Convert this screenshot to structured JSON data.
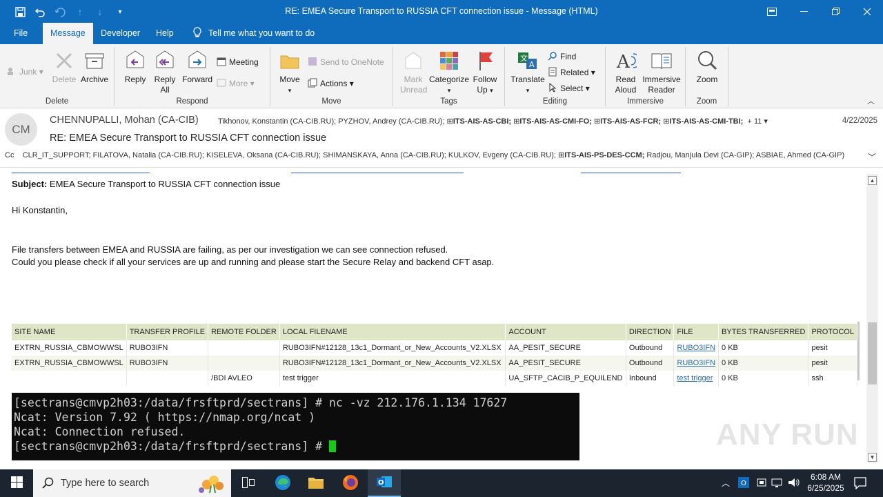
{
  "window": {
    "title": "RE: EMEA Secure Transport to RUSSIA CFT connection issue  -  Message (HTML)"
  },
  "menu": {
    "tabs": [
      "File",
      "Message",
      "Developer",
      "Help"
    ],
    "active_tab": "Message",
    "tell_me": "Tell me what you want to do"
  },
  "ribbon": {
    "groups": {
      "delete": "Delete",
      "respond": "Respond",
      "move": "Move",
      "tags": "Tags",
      "editing": "Editing",
      "immersive": "Immersive",
      "zoom": "Zoom"
    },
    "junk": "Junk",
    "delete_btn": "Delete",
    "archive": "Archive",
    "reply": "Reply",
    "reply_all_1": "Reply",
    "reply_all_2": "All",
    "forward": "Forward",
    "meeting": "Meeting",
    "more": "More",
    "move_btn": "Move",
    "send_onenote": "Send to OneNote",
    "actions": "Actions",
    "mark_unread_1": "Mark",
    "mark_unread_2": "Unread",
    "categorize": "Categorize",
    "follow_up_1": "Follow",
    "follow_up_2": "Up",
    "translate": "Translate",
    "find": "Find",
    "related": "Related",
    "select": "Select",
    "read_aloud_1": "Read",
    "read_aloud_2": "Aloud",
    "immersive_reader_1": "Immersive",
    "immersive_reader_2": "Reader",
    "zoom_btn": "Zoom"
  },
  "header": {
    "avatar_initials": "CM",
    "sender": "CHENNUPALLI, Mohan (CA-CIB)",
    "to_plain": "Tikhonov, Konstantin (CA-CIB.RU); PYZHOV, Andrey (CA-CIB.RU);",
    "to_groups": [
      "ITS-AIS-AS-CBI;",
      "ITS-AIS-AS-CMI-FO;",
      "ITS-AIS-AS-FCR;",
      "ITS-AIS-AS-CMI-TBI;"
    ],
    "to_more": "+ 11",
    "date": "4/22/2025",
    "subject": "RE: EMEA Secure Transport to RUSSIA CFT connection issue",
    "cc_label": "Cc",
    "cc_plain_1": "CLR_IT_SUPPORT; FILATOVA, Natalia (CA-CIB.RU); KISELEVA, Oksana (CA-CIB.RU); SHIMANSKAYA, Anna (CA-CIB.RU); KULKOV, Evgeny (CA-CIB.RU);",
    "cc_group": "ITS-AIS-PS-DES-CCM;",
    "cc_plain_2": "Radjou, Manjula Devi (CA-GIP); ASBIAE, Ahmed (CA-GIP)"
  },
  "body": {
    "subject_label": "Subject:",
    "subject_text": "EMEA Secure Transport to RUSSIA CFT connection issue",
    "greeting": "Hi Konstantin,",
    "para1": "File transfers between EMEA and RUSSIA are failing, as per our investigation we can see connection refused.",
    "para2": "Could you please check if all your services are up and running  and please start the Secure Relay and backend CFT asap."
  },
  "table": {
    "headers": [
      "SITE NAME",
      "TRANSFER PROFILE",
      "REMOTE FOLDER",
      "LOCAL FILENAME",
      "ACCOUNT",
      "DIRECTION",
      "FILE",
      "BYTES TRANSFERRED",
      "PROTOCOL"
    ],
    "rows": [
      [
        "EXTRN_RUSSIA_CBMOWWSL",
        "RUBO3IFN",
        "",
        "RUBO3IFN#12128_13c1_Dormant_or_New_Accounts_V2.XLSX",
        "AA_PESIT_SECURE",
        "Outbound",
        "RUBO3IFN",
        "0 KB",
        "pesit"
      ],
      [
        "EXTRN_RUSSIA_CBMOWWSL",
        "RUBO3IFN",
        "",
        "RUBO3IFN#12128_13c1_Dormant_or_New_Accounts_V2.XLSX",
        "AA_PESIT_SECURE",
        "Outbound",
        "RUBO3IFN",
        "0 KB",
        "pesit"
      ],
      [
        "",
        "",
        "/BDI AVLEO",
        "test trigger",
        "UA_SFTP_CACIB_P_EQUILEND",
        "Inbound",
        "test trigger",
        "0 KB",
        "ssh"
      ]
    ]
  },
  "terminal": {
    "line1": "[sectrans@cmvp2h03:/data/frsftprd/sectrans] # nc -vz 212.176.1.134 17627",
    "line2": "Ncat: Version 7.92 ( https://nmap.org/ncat )",
    "line3": "Ncat: Connection refused.",
    "line4": "[sectrans@cmvp2h03:/data/frsftprd/sectrans] # "
  },
  "watermark": "ANY RUN",
  "taskbar": {
    "search_placeholder": "Type here to search",
    "time": "6:08 AM",
    "date": "6/25/2025"
  },
  "colors": {
    "brand": "#0f6cbd",
    "table_header": "#dfe6c8",
    "terminal_bg": "#0c0c0c",
    "cursor": "#10d010"
  },
  "icons": [
    "save-icon",
    "undo-icon",
    "redo-icon",
    "up-arrow-icon",
    "down-arrow-icon",
    "lightbulb-icon",
    "windows-icon",
    "search-icon",
    "task-view-icon",
    "edge-icon",
    "file-explorer-icon",
    "firefox-icon",
    "outlook-icon"
  ]
}
